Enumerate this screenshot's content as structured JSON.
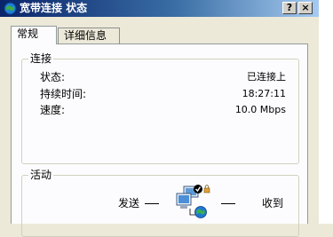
{
  "window": {
    "title": "宽带连接 状态",
    "help_label": "?",
    "close_label": "×"
  },
  "tabs": [
    {
      "label": "常规",
      "active": true
    },
    {
      "label": "详细信息",
      "active": false
    }
  ],
  "connection": {
    "legend": "连接",
    "rows": [
      {
        "label": "状态:",
        "value": "已连接上"
      },
      {
        "label": "持续时间:",
        "value": "18:27:11"
      },
      {
        "label": "速度:",
        "value": "10.0 Mbps"
      }
    ]
  },
  "activity": {
    "legend": "活动",
    "sent_label": "发送",
    "received_label": "收到",
    "dash": "—"
  },
  "colors": {
    "titlebar_start": "#0a246a",
    "titlebar_end": "#a6caf0",
    "panel_bg": "#fcfcfe",
    "window_bg": "#ece9d8"
  },
  "icons": {
    "title": "network-globe-icon",
    "activity": "network-computers-icon"
  }
}
